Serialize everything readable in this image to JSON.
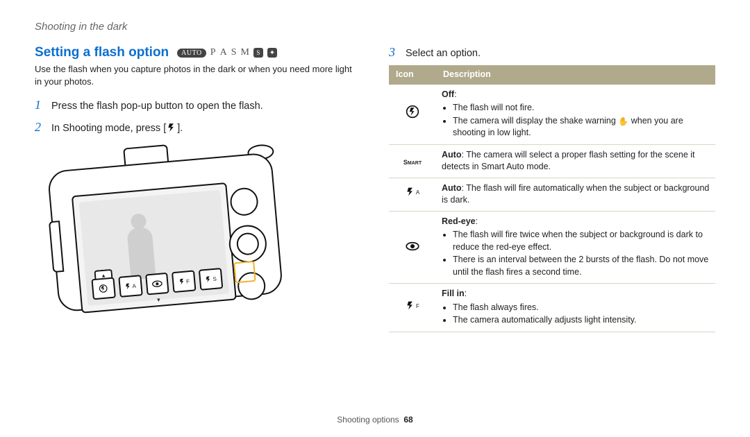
{
  "breadcrumb": "Shooting in the dark",
  "left": {
    "heading": "Setting a flash option",
    "modes": {
      "auto_badge": "AUTO",
      "p": "P",
      "a": "A",
      "s": "S",
      "m": "M",
      "s_badge": "S"
    },
    "intro": "Use the flash when you capture photos in the dark or when you need more light in your photos.",
    "steps": {
      "s1_num": "1",
      "s1_text": "Press the flash pop-up button to open the flash.",
      "s2_num": "2",
      "s2_text_a": "In Shooting mode, press [",
      "s2_text_b": "]."
    }
  },
  "right": {
    "step_num": "3",
    "step_text": "Select an option.",
    "header_icon": "Icon",
    "header_desc": "Description",
    "rows": {
      "r0": {
        "title": "Off",
        "b1": "The flash will not fire.",
        "b2a": "The camera will display the shake warning ",
        "b2b": " when you are shooting in low light."
      },
      "r1": {
        "title": "Auto",
        "text": ": The camera will select a proper flash setting for the scene it detects in Smart Auto mode."
      },
      "r2": {
        "title": "Auto",
        "text": ": The flash will fire automatically when the subject or background is dark."
      },
      "r3": {
        "title": "Red-eye",
        "b1": "The flash will fire twice when the subject or background is dark to reduce the red-eye effect.",
        "b2": "There is an interval between the 2 bursts of the flash. Do not move until the flash fires a second time."
      },
      "r4": {
        "title": "Fill in",
        "b1": "The flash always fires.",
        "b2": "The camera automatically adjusts light intensity."
      }
    }
  },
  "footer": {
    "section": "Shooting options",
    "page": "68"
  }
}
